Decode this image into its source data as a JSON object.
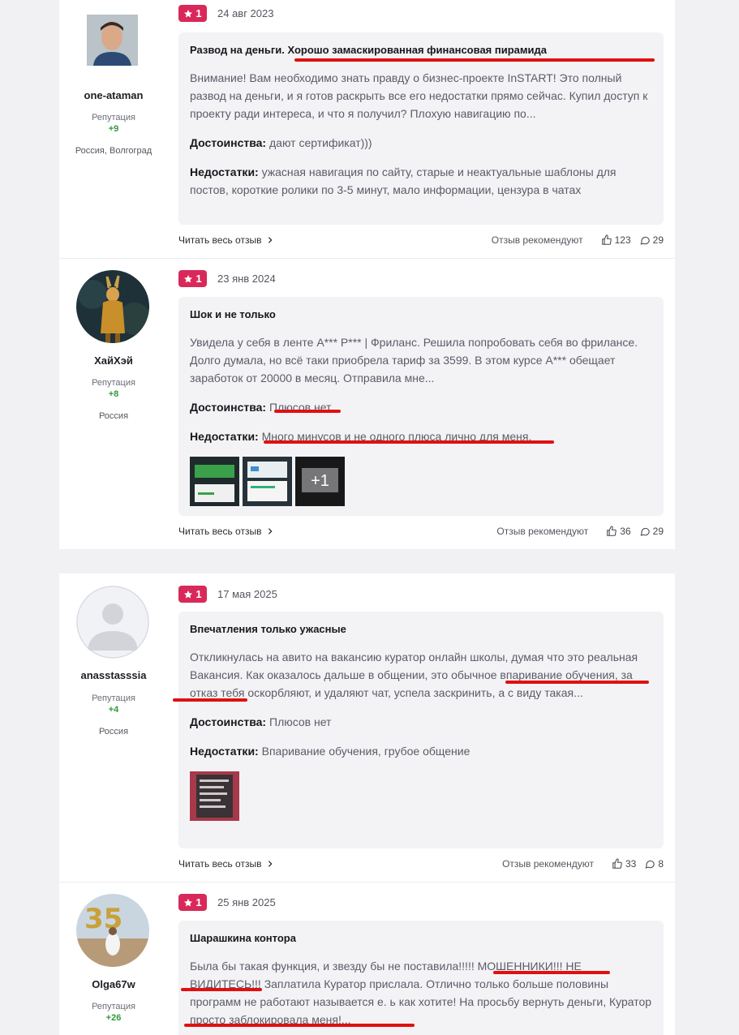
{
  "reviews": [
    {
      "username": "one-ataman",
      "rep_label": "Репутация",
      "rep_value": "+9",
      "city": "Россия, Волгоград",
      "rating": "1",
      "date": "24 авг 2023",
      "title": "Развод на деньги. Хорошо замаскированная финансовая пирамида",
      "text": "Внимание! Вам необходимо знать правду о бизнес-проекте InSTART! Это полный развод на деньги, и я готов раскрыть все его недостатки прямо сейчас. Купил доступ к проекту ради интереса, и что я получил? Плохую навигацию по...",
      "pros_label": "Достоинства:",
      "pros": "дают сертификат)))",
      "cons_label": "Недостатки:",
      "cons": "ужасная навигация по сайту, старые и неактуальные шаблоны для постов, короткие ролики по 3-5 минут, мало информации, цензура в чатах",
      "read_more": "Читать весь отзыв",
      "recommend": "Отзыв рекомендуют",
      "likes": "123",
      "comments": "29"
    },
    {
      "username": "ХайХэй",
      "rep_label": "Репутация",
      "rep_value": "+8",
      "city": "Россия",
      "rating": "1",
      "date": "23 янв 2024",
      "title": "Шок и не только",
      "text": "Увидела у себя в ленте А*** Р*** | Фриланс. Решила попробовать себя во фрилансе. Долго думала, но всё таки приобрела тариф за 3599. В этом курсе А*** обещает заработок от 20000 в месяц. Отправила мне...",
      "pros_label": "Достоинства:",
      "pros": "Плюсов нет.",
      "cons_label": "Недостатки:",
      "cons": "Много минусов и не одного плюса лично для меня.",
      "more_photos": "+1",
      "read_more": "Читать весь отзыв",
      "recommend": "Отзыв рекомендуют",
      "likes": "36",
      "comments": "29"
    },
    {
      "username": "anasstasssia",
      "rep_label": "Репутация",
      "rep_value": "+4",
      "city": "Россия",
      "rating": "1",
      "date": "17 мая 2025",
      "title": "Впечатления только ужасные",
      "text": "Откликнулась на авито на вакансию куратор онлайн школы, думая что это реальная Вакансия. Как оказалось дальше в общении, это обычное впаривание обучения, за отказ тебя оскорбляют, и удаляют чат, успела заскринить, а с виду такая...",
      "pros_label": "Достоинства:",
      "pros": "Плюсов нет",
      "cons_label": "Недостатки:",
      "cons": "Впаривание обучения, грубое общение",
      "read_more": "Читать весь отзыв",
      "recommend": "Отзыв рекомендуют",
      "likes": "33",
      "comments": "8"
    },
    {
      "username": "Olga67w",
      "rep_label": "Репутация",
      "rep_value": "+26",
      "rating": "1",
      "date": "25 янв 2025",
      "title": "Шарашкина контора",
      "text": "Была бы такая функция, и звезду бы не поставила!!!!! МОШЕННИКИ!!! НЕ ВИДИТЕСЬ!!! Заплатила Куратор прислала. Отлично только больше половины программ не работают называется е. ь как хотите! На просьбу вернуть деньги, Куратор просто заблокировала меня!..."
    }
  ],
  "colors": {
    "badge": "#d8295a",
    "rep": "#2e9a3b",
    "underline": "#e01010"
  }
}
